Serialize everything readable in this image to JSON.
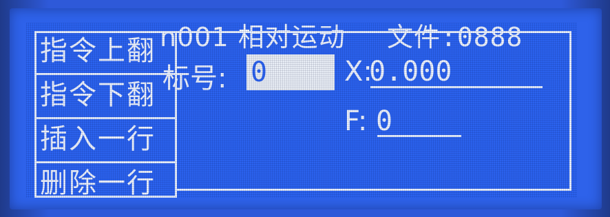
{
  "menu": {
    "items": [
      {
        "label": "指令上翻"
      },
      {
        "label": "指令下翻"
      },
      {
        "label": "插入一行"
      },
      {
        "label": "删除一行"
      }
    ]
  },
  "header": {
    "instruction": "n001 相对运动",
    "file": "文件:0888"
  },
  "form": {
    "biaohao_label": "标号:",
    "biaohao_value": "0",
    "x_label": "X:",
    "x_value": "0.000",
    "f_label": "F:",
    "f_value": "0"
  },
  "colors": {
    "lcd_background": "#2b63f0",
    "lcd_foreground": "#eef4ff",
    "highlight_box": "#e9eef6"
  }
}
